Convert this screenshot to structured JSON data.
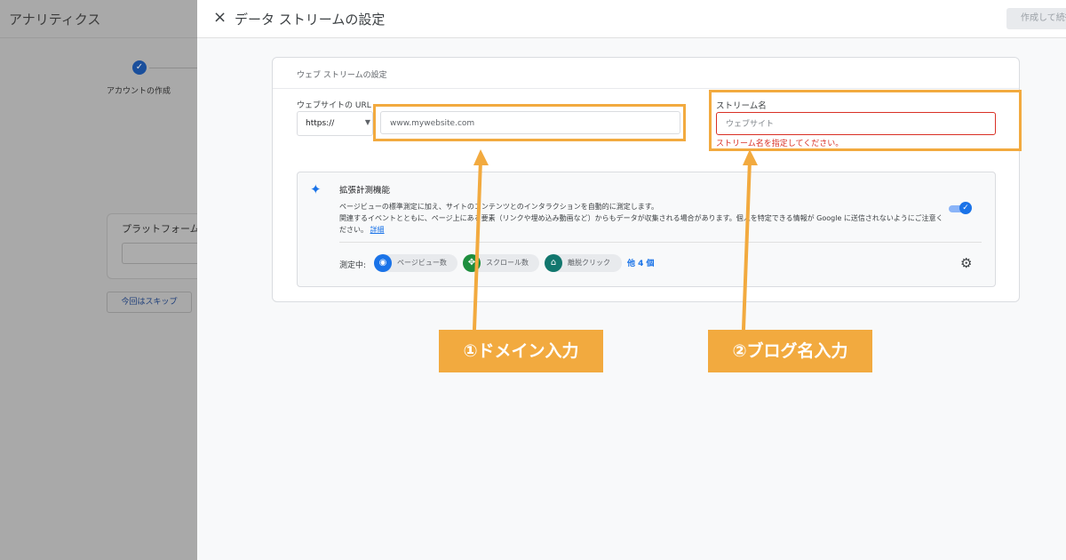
{
  "background": {
    "app_title": "アナリティクス",
    "step_label": "アカウントの作成",
    "step_check": "✓",
    "platform_title": "プラットフォーム",
    "skip_button": "今回はスキップ"
  },
  "dialog": {
    "title": "データ ストリームの設定",
    "close_icon": "×",
    "continue_button": "作成して続行"
  },
  "panel": {
    "title": "ウェブ ストリームの設定",
    "url_label": "ウェブサイトの URL",
    "protocol_value": "https://",
    "protocol_caret": "▼",
    "url_placeholder": "www.mywebsite.com",
    "stream_label": "ストリーム名",
    "stream_placeholder": "ウェブサイト",
    "stream_error": "ストリーム名を指定してください。"
  },
  "enhanced": {
    "icon": "✦",
    "title": "拡張計測機能",
    "desc_line1": "ページビューの標準測定に加え、サイトのコンテンツとのインタラクションを自動的に測定します。",
    "desc_line2": "関連するイベントとともに、ページ上にある要素（リンクや埋め込み動画など）からもデータが収集される場合があります。個人を特定できる情報が Google に送信されないようにご注意く",
    "desc_line3": "ださい。",
    "details_link": "詳細",
    "toggle_on": true,
    "toggle_check": "✓",
    "measuring_label": "測定中:",
    "chips": [
      {
        "label": "ページビュー数",
        "icon": "eye-icon",
        "glyph": "◉",
        "color": "#1a73e8"
      },
      {
        "label": "スクロール数",
        "icon": "scroll-icon",
        "glyph": "✥",
        "color": "#1e8e3e"
      },
      {
        "label": "離脱クリック",
        "icon": "mouse-icon",
        "glyph": "⌂",
        "color": "#12776e"
      }
    ],
    "more_link": "他 4 個",
    "gear_glyph": "⚙"
  },
  "annotations": {
    "label1": "①ドメイン入力",
    "label2": "②ブログ名入力",
    "color": "#f2aa3f"
  }
}
